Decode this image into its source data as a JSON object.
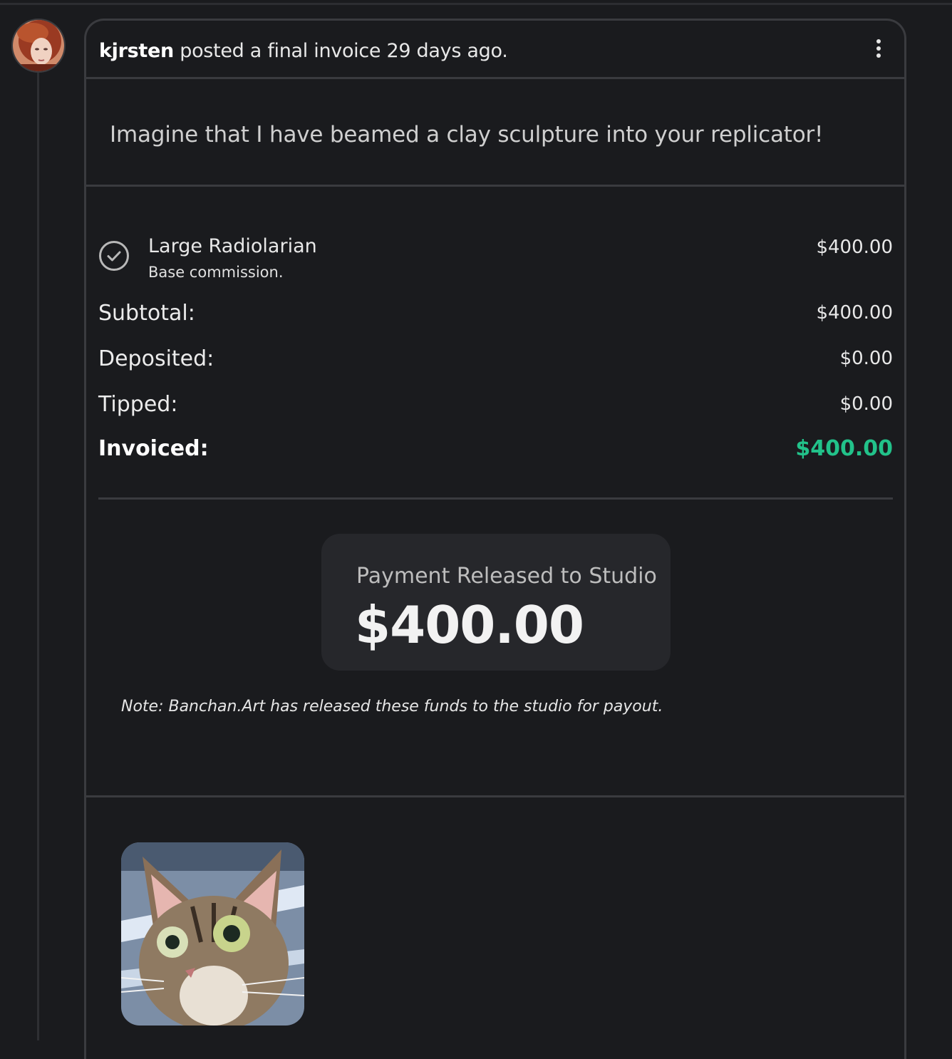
{
  "event": {
    "username": "kjrsten",
    "action_text": "posted a final invoice 29 days ago."
  },
  "message": "Imagine that I have beamed a clay sculpture into your replicator!",
  "invoice": {
    "item": {
      "name": "Large Radiolarian",
      "description": "Base commission.",
      "amount": "$400.00"
    },
    "rows": {
      "subtotal_label": "Subtotal:",
      "subtotal_value": "$400.00",
      "deposited_label": "Deposited:",
      "deposited_value": "$0.00",
      "tipped_label": "Tipped:",
      "tipped_value": "$0.00",
      "invoiced_label": "Invoiced:",
      "invoiced_value": "$400.00"
    },
    "payment": {
      "title": "Payment Released to Studio",
      "amount": "$400.00"
    },
    "note": "Note: Banchan.Art has released these funds to the studio for payout."
  },
  "colors": {
    "background": "#1a1b1e",
    "border": "#3a3b3f",
    "accent_green": "#22c28a",
    "payment_box": "#26272b"
  },
  "icons": {
    "menu": "vertical-ellipsis-icon",
    "item_status": "check-circle-icon"
  }
}
